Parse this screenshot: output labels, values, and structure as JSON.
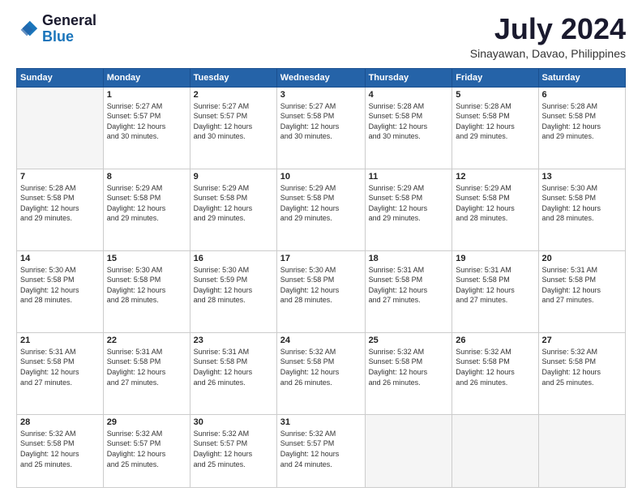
{
  "header": {
    "logo_line1": "General",
    "logo_line2": "Blue",
    "month_title": "July 2024",
    "location": "Sinayawan, Davao, Philippines"
  },
  "days_of_week": [
    "Sunday",
    "Monday",
    "Tuesday",
    "Wednesday",
    "Thursday",
    "Friday",
    "Saturday"
  ],
  "weeks": [
    [
      {
        "day": "",
        "info": ""
      },
      {
        "day": "1",
        "info": "Sunrise: 5:27 AM\nSunset: 5:57 PM\nDaylight: 12 hours\nand 30 minutes."
      },
      {
        "day": "2",
        "info": "Sunrise: 5:27 AM\nSunset: 5:57 PM\nDaylight: 12 hours\nand 30 minutes."
      },
      {
        "day": "3",
        "info": "Sunrise: 5:27 AM\nSunset: 5:58 PM\nDaylight: 12 hours\nand 30 minutes."
      },
      {
        "day": "4",
        "info": "Sunrise: 5:28 AM\nSunset: 5:58 PM\nDaylight: 12 hours\nand 30 minutes."
      },
      {
        "day": "5",
        "info": "Sunrise: 5:28 AM\nSunset: 5:58 PM\nDaylight: 12 hours\nand 29 minutes."
      },
      {
        "day": "6",
        "info": "Sunrise: 5:28 AM\nSunset: 5:58 PM\nDaylight: 12 hours\nand 29 minutes."
      }
    ],
    [
      {
        "day": "7",
        "info": "Sunrise: 5:28 AM\nSunset: 5:58 PM\nDaylight: 12 hours\nand 29 minutes."
      },
      {
        "day": "8",
        "info": "Sunrise: 5:29 AM\nSunset: 5:58 PM\nDaylight: 12 hours\nand 29 minutes."
      },
      {
        "day": "9",
        "info": "Sunrise: 5:29 AM\nSunset: 5:58 PM\nDaylight: 12 hours\nand 29 minutes."
      },
      {
        "day": "10",
        "info": "Sunrise: 5:29 AM\nSunset: 5:58 PM\nDaylight: 12 hours\nand 29 minutes."
      },
      {
        "day": "11",
        "info": "Sunrise: 5:29 AM\nSunset: 5:58 PM\nDaylight: 12 hours\nand 29 minutes."
      },
      {
        "day": "12",
        "info": "Sunrise: 5:29 AM\nSunset: 5:58 PM\nDaylight: 12 hours\nand 28 minutes."
      },
      {
        "day": "13",
        "info": "Sunrise: 5:30 AM\nSunset: 5:58 PM\nDaylight: 12 hours\nand 28 minutes."
      }
    ],
    [
      {
        "day": "14",
        "info": "Sunrise: 5:30 AM\nSunset: 5:58 PM\nDaylight: 12 hours\nand 28 minutes."
      },
      {
        "day": "15",
        "info": "Sunrise: 5:30 AM\nSunset: 5:58 PM\nDaylight: 12 hours\nand 28 minutes."
      },
      {
        "day": "16",
        "info": "Sunrise: 5:30 AM\nSunset: 5:59 PM\nDaylight: 12 hours\nand 28 minutes."
      },
      {
        "day": "17",
        "info": "Sunrise: 5:30 AM\nSunset: 5:58 PM\nDaylight: 12 hours\nand 28 minutes."
      },
      {
        "day": "18",
        "info": "Sunrise: 5:31 AM\nSunset: 5:58 PM\nDaylight: 12 hours\nand 27 minutes."
      },
      {
        "day": "19",
        "info": "Sunrise: 5:31 AM\nSunset: 5:58 PM\nDaylight: 12 hours\nand 27 minutes."
      },
      {
        "day": "20",
        "info": "Sunrise: 5:31 AM\nSunset: 5:58 PM\nDaylight: 12 hours\nand 27 minutes."
      }
    ],
    [
      {
        "day": "21",
        "info": "Sunrise: 5:31 AM\nSunset: 5:58 PM\nDaylight: 12 hours\nand 27 minutes."
      },
      {
        "day": "22",
        "info": "Sunrise: 5:31 AM\nSunset: 5:58 PM\nDaylight: 12 hours\nand 27 minutes."
      },
      {
        "day": "23",
        "info": "Sunrise: 5:31 AM\nSunset: 5:58 PM\nDaylight: 12 hours\nand 26 minutes."
      },
      {
        "day": "24",
        "info": "Sunrise: 5:32 AM\nSunset: 5:58 PM\nDaylight: 12 hours\nand 26 minutes."
      },
      {
        "day": "25",
        "info": "Sunrise: 5:32 AM\nSunset: 5:58 PM\nDaylight: 12 hours\nand 26 minutes."
      },
      {
        "day": "26",
        "info": "Sunrise: 5:32 AM\nSunset: 5:58 PM\nDaylight: 12 hours\nand 26 minutes."
      },
      {
        "day": "27",
        "info": "Sunrise: 5:32 AM\nSunset: 5:58 PM\nDaylight: 12 hours\nand 25 minutes."
      }
    ],
    [
      {
        "day": "28",
        "info": "Sunrise: 5:32 AM\nSunset: 5:58 PM\nDaylight: 12 hours\nand 25 minutes."
      },
      {
        "day": "29",
        "info": "Sunrise: 5:32 AM\nSunset: 5:57 PM\nDaylight: 12 hours\nand 25 minutes."
      },
      {
        "day": "30",
        "info": "Sunrise: 5:32 AM\nSunset: 5:57 PM\nDaylight: 12 hours\nand 25 minutes."
      },
      {
        "day": "31",
        "info": "Sunrise: 5:32 AM\nSunset: 5:57 PM\nDaylight: 12 hours\nand 24 minutes."
      },
      {
        "day": "",
        "info": ""
      },
      {
        "day": "",
        "info": ""
      },
      {
        "day": "",
        "info": ""
      }
    ]
  ]
}
